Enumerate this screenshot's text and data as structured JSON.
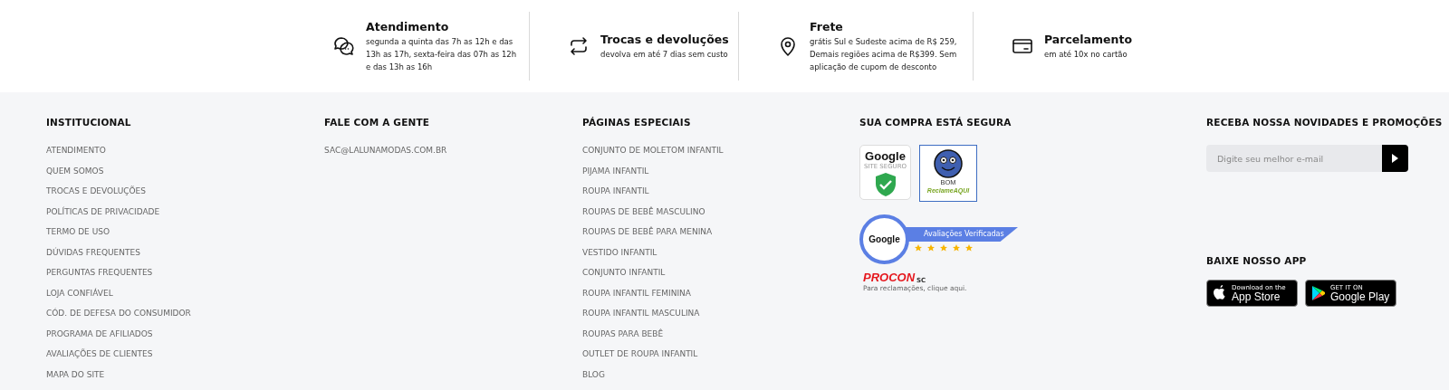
{
  "features": [
    {
      "kind": "chat",
      "title": "Atendimento",
      "text": "segunda a quinta das 7h as 12h e das 13h as 17h, sexta-feira das 07h as 12h e das 13h as 16h"
    },
    {
      "kind": "exchange",
      "title": "Trocas e devoluções",
      "text": "devolva em até 7 dias sem custo"
    },
    {
      "kind": "pin",
      "title": "Frete",
      "text": "grátis Sul e Sudeste acima de R$ 259, Demais regiões acima de R$399. Sem aplicação de cupom de desconto"
    },
    {
      "kind": "card",
      "title": "Parcelamento",
      "text": "em até 10x no cartão"
    }
  ],
  "institucional": {
    "heading": "INSTITUCIONAL",
    "links": [
      "ATENDIMENTO",
      "QUEM SOMOS",
      "TROCAS E DEVOLUÇÕES",
      "POLÍTICAS DE PRIVACIDADE",
      "TERMO DE USO",
      "DÚVIDAS FREQUENTES",
      "PERGUNTAS FREQUENTES",
      "LOJA CONFIÁVEL",
      "CÓD. DE DEFESA DO CONSUMIDOR",
      "PROGRAMA DE AFILIADOS",
      "AVALIAÇÕES DE CLIENTES",
      "MAPA DO SITE"
    ]
  },
  "contato": {
    "heading": "FALE COM A GENTE",
    "links": [
      "SAC@LALUNAMODAS.COM.BR"
    ]
  },
  "paginas_especiais": {
    "heading": "PÁGINAS ESPECIAIS",
    "links": [
      "CONJUNTO DE MOLETOM INFANTIL",
      "PIJAMA INFANTIL",
      "ROUPA INFANTIL",
      "ROUPAS DE BEBÊ MASCULINO",
      "ROUPAS DE BEBÊ PARA MENINA",
      "VESTIDO INFANTIL",
      "CONJUNTO INFANTIL",
      "ROUPA INFANTIL FEMININA",
      "ROUPA INFANTIL MASCULINA",
      "ROUPAS PARA BEBÊ",
      "OUTLET DE ROUPA INFANTIL",
      "BLOG"
    ]
  },
  "seguranca": {
    "heading": "SUA COMPRA ESTÁ SEGURA",
    "site_seguro": {
      "brand": "Google",
      "label": "SITE SEGURO"
    },
    "reclame_aqui": {
      "rating": "BOM",
      "brand": "ReclameAQUI"
    },
    "avaliacoes": {
      "brand": "Google",
      "label": "Avaliações Verificadas",
      "stars": 5
    },
    "procon": {
      "brand": "PROCON",
      "state": "SC",
      "caption": "Para reclamações, clique aqui."
    }
  },
  "newsletter": {
    "heading": "RECEBA NOSSA NOVIDADES E PROMOÇÕES",
    "placeholder": "Digite seu melhor e-mail"
  },
  "app": {
    "heading": "BAIXE NOSSO APP",
    "stores": [
      {
        "kind": "apple",
        "small": "Download on the",
        "big": "App Store"
      },
      {
        "kind": "google",
        "small": "GET IT ON",
        "big": "Google Play"
      }
    ]
  }
}
